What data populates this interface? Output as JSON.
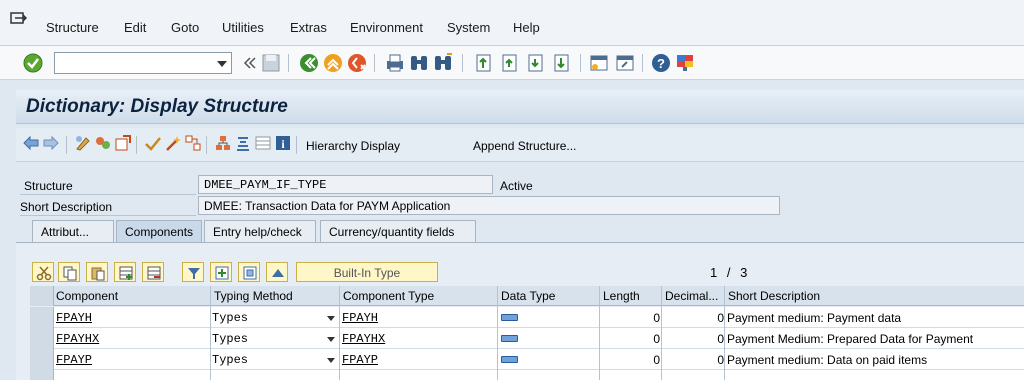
{
  "menu": [
    "Structure",
    "Edit",
    "Goto",
    "Utilities",
    "Extras",
    "Environment",
    "System",
    "Help"
  ],
  "command_field": {
    "value": ""
  },
  "title": "Dictionary: Display Structure",
  "app_toolbar": {
    "hierarchy_display": "Hierarchy Display",
    "append_structure": "Append Structure..."
  },
  "form": {
    "structure_label": "Structure",
    "structure_value": "DMEE_PAYM_IF_TYPE",
    "status": "Active",
    "short_desc_label": "Short Description",
    "short_desc_value": "DMEE: Transaction Data for PAYM Application"
  },
  "tabs": [
    "Attribut...",
    "Components",
    "Entry help/check",
    "Currency/quantity fields"
  ],
  "active_tab": "Components",
  "table_toolbar": {
    "builtin_type": "Built-In Type"
  },
  "pagination": {
    "current": "1",
    "separator": "/",
    "total": "3"
  },
  "table": {
    "columns": [
      "Component",
      "Typing Method",
      "Component Type",
      "Data Type",
      "Length",
      "Decimal...",
      "Short Description"
    ],
    "rows": [
      {
        "component": "FPAYH",
        "typing": "Types",
        "type": "FPAYH",
        "length": "0",
        "decimals": "0",
        "desc": "Payment medium: Payment data"
      },
      {
        "component": "FPAYHX",
        "typing": "Types",
        "type": "FPAYHX",
        "length": "0",
        "decimals": "0",
        "desc": "Payment Medium: Prepared Data for Payment"
      },
      {
        "component": "FPAYP",
        "typing": "Types",
        "type": "FPAYP",
        "length": "0",
        "decimals": "0",
        "desc": "Payment medium: Data on paid items"
      }
    ]
  }
}
